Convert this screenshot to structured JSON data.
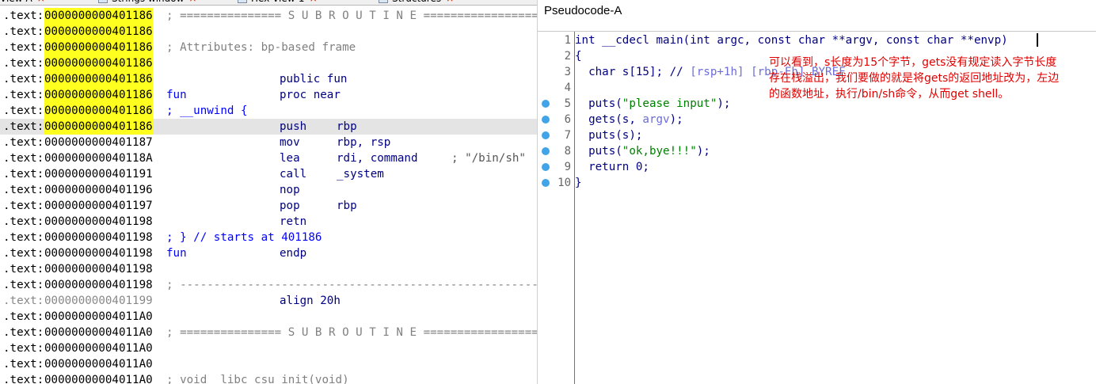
{
  "ida": {
    "tabs": [
      {
        "label": "View-A",
        "close": "×"
      },
      {
        "label": "Strings window",
        "close": "×"
      },
      {
        "label": "Hex View-1",
        "close": "×"
      },
      {
        "label": "Structures",
        "close": "×"
      }
    ],
    "rows": [
      {
        "seg": ".text:",
        "addr": "0000000000401186",
        "hl": true,
        "sep": "; =============== S U B R O U T I N E ======================================="
      },
      {
        "seg": ".text:",
        "addr": "0000000000401186",
        "hl": true
      },
      {
        "seg": ".text:",
        "addr": "0000000000401186",
        "hl": true,
        "comment": "; Attributes: bp-based frame"
      },
      {
        "seg": ".text:",
        "addr": "0000000000401186",
        "hl": true
      },
      {
        "seg": ".text:",
        "addr": "0000000000401186",
        "hl": true,
        "mn": "public fun"
      },
      {
        "seg": ".text:",
        "addr": "0000000000401186",
        "hl": true,
        "label": "fun",
        "mn": "proc near"
      },
      {
        "seg": ".text:",
        "addr": "0000000000401186",
        "hl": true,
        "blue": "; __unwind {"
      },
      {
        "seg": ".text:",
        "addr": "0000000000401186",
        "hl": true,
        "selected": true,
        "mn": "push",
        "op": "rbp"
      },
      {
        "seg": ".text:",
        "addr": "0000000000401187",
        "mn": "mov",
        "op": "rbp, rsp"
      },
      {
        "seg": ".text:",
        "addr": "000000000040118A",
        "mn": "lea",
        "op": "rdi, command",
        "cmt": "; \"/bin/sh\""
      },
      {
        "seg": ".text:",
        "addr": "0000000000401191",
        "mn": "call",
        "op": "_system"
      },
      {
        "seg": ".text:",
        "addr": "0000000000401196",
        "mn": "nop"
      },
      {
        "seg": ".text:",
        "addr": "0000000000401197",
        "mn": "pop",
        "op": "rbp"
      },
      {
        "seg": ".text:",
        "addr": "0000000000401198",
        "mn": "retn"
      },
      {
        "seg": ".text:",
        "addr": "0000000000401198",
        "blue": "; } // starts at 401186"
      },
      {
        "seg": ".text:",
        "addr": "0000000000401198",
        "label": "fun",
        "mn": "endp"
      },
      {
        "seg": ".text:",
        "addr": "0000000000401198"
      },
      {
        "seg": ".text:",
        "addr": "0000000000401198",
        "sep": "; ---------------------------------------------------------------------------"
      },
      {
        "seg": ".text:",
        "addr": "0000000000401199",
        "gray": true,
        "mn": "align 20h"
      },
      {
        "seg": ".text:",
        "addr": "00000000004011A0"
      },
      {
        "seg": ".text:",
        "addr": "00000000004011A0",
        "sep": "; =============== S U B R O U T I N E ======================================="
      },
      {
        "seg": ".text:",
        "addr": "00000000004011A0"
      },
      {
        "seg": ".text:",
        "addr": "00000000004011A0"
      },
      {
        "seg": ".text:",
        "addr": "00000000004011A0",
        "comment": "; void _libc_csu_init(void)"
      }
    ]
  },
  "pseudocode": {
    "title": "Pseudocode-A",
    "lines": [
      {
        "num": "1",
        "dot": false,
        "parts": [
          [
            "k",
            "int __cdecl main(int argc, const char **argv, const char **envp)"
          ]
        ]
      },
      {
        "num": "2",
        "dot": false,
        "parts": [
          [
            "k",
            "{"
          ]
        ]
      },
      {
        "num": "3",
        "dot": false,
        "parts": [
          [
            "k",
            "  char s[15]; // "
          ],
          [
            "cm",
            "[rsp+1h] [rbp-Fh] BYREF"
          ]
        ]
      },
      {
        "num": "4",
        "dot": false,
        "parts": [
          [
            "k",
            ""
          ]
        ]
      },
      {
        "num": "5",
        "dot": true,
        "parts": [
          [
            "k",
            "  puts("
          ],
          [
            "str",
            "\"please input\""
          ],
          [
            "k",
            ");"
          ]
        ]
      },
      {
        "num": "6",
        "dot": true,
        "parts": [
          [
            "k",
            "  gets(s, "
          ],
          [
            "var",
            "argv"
          ],
          [
            "k",
            ");"
          ]
        ]
      },
      {
        "num": "7",
        "dot": true,
        "parts": [
          [
            "k",
            "  puts(s);"
          ]
        ]
      },
      {
        "num": "8",
        "dot": true,
        "parts": [
          [
            "k",
            "  puts("
          ],
          [
            "str",
            "\"ok,bye!!!\""
          ],
          [
            "k",
            ");"
          ]
        ]
      },
      {
        "num": "9",
        "dot": true,
        "parts": [
          [
            "k",
            "  return 0;"
          ]
        ]
      },
      {
        "num": "10",
        "dot": true,
        "parts": [
          [
            "k",
            "}"
          ]
        ]
      }
    ],
    "annotation": "可以看到，s长度为15个字节，gets没有规定读入字节长度\n存在栈溢出，我们要做的就是将gets的返回地址改为，左边\n的函数地址，执行/bin/sh命令，从而get shell。"
  },
  "colors": {
    "highlight": "#ffff1f",
    "label_blue": "#0000ff",
    "instr_navy": "#000080",
    "string_green": "#008000",
    "annotation_red": "#e00000",
    "breakpoint_dot": "#41a4e8"
  }
}
